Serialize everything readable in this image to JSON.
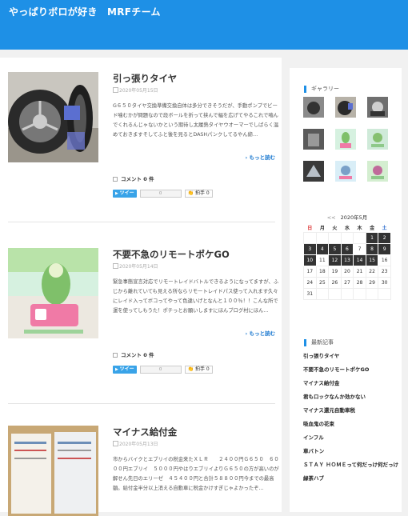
{
  "site": {
    "title": "やっぱりボロが好き　MRFチーム"
  },
  "posts": [
    {
      "title": "引っ張りタイヤ",
      "date": "2020年05月15日",
      "excerpt": "G６５０タイヤ交換準備交換自体は多分できそうだが、手動ポンプでビード噛むかが問題なので段ボールを折って挟んで幅を広げてやるこれで嚙んでくれるんじゃないかという期待し太履熱タイヤウオーマーでしばらく温めておきますそしてふと後を見るとDASHパンクしてるやん締…",
      "more": "もっと読む",
      "comment": "コメント 0 件",
      "tweet": "ツイー",
      "count": "0",
      "clap": "拍手 0"
    },
    {
      "title": "不要不急のリモートポケGO",
      "date": "2020年05月14日",
      "excerpt": "緊急事態宣言対応でリモートレイドバトルできるようになってますが、ふじから離れていても見える所ならリモートレイドパス使って入れます久々にレイド入ってボコってやって色違いげとなんと１００％！！こんな所で運を使ってしもうた！ポチっとお願いしますにほんブログ村にほん…",
      "more": "もっと読む",
      "comment": "コメント 0 件",
      "tweet": "ツイー",
      "count": "0",
      "clap": "拍手 0"
    },
    {
      "title": "マイナス給付金",
      "date": "2020年05月13日",
      "excerpt": "市からバイクとエブリイの税金来たＸＬＲ　　２４００円Ｇ６５０　６０００円エブリイ　５０００円やはりエブリイよりＧ６５０の方が高いのが解せん先日のエリーゼ　４５４００円と合計５８８００円今までの最高額。給付金半分以上消える自動車に税金かけすぎじゃよかったぞ…"
    }
  ],
  "sidebar": {
    "gallery_title": "ギャラリー",
    "calendar": {
      "prev": "<<",
      "title": "2020年5月",
      "weekdays": [
        "日",
        "月",
        "火",
        "水",
        "木",
        "金",
        "土"
      ],
      "rows": [
        [
          "",
          "",
          "",
          "",
          "",
          "1",
          "2"
        ],
        [
          "3",
          "4",
          "5",
          "6",
          "7",
          "8",
          "9"
        ],
        [
          "10",
          "11",
          "12",
          "13",
          "14",
          "15",
          "16"
        ],
        [
          "17",
          "18",
          "19",
          "20",
          "21",
          "22",
          "23"
        ],
        [
          "24",
          "25",
          "26",
          "27",
          "28",
          "29",
          "30"
        ],
        [
          "31",
          "",
          "",
          "",
          "",
          "",
          ""
        ]
      ],
      "active_days": [
        "1",
        "2",
        "3",
        "4",
        "5",
        "6",
        "8",
        "9",
        "10",
        "12",
        "13",
        "14",
        "15"
      ]
    },
    "recent_title": "最新記事",
    "recent": [
      "引っ張りタイヤ",
      "不要不急のリモートポケGO",
      "マイナス給付金",
      "君もロックなんか効かない",
      "マイナス還元自動車税",
      "吸血鬼の花束",
      "インフル",
      "車バトン",
      "ＳＴＡＹ ＨＯＭＥって何だっけ何だっけ",
      "緑茶ハブ"
    ]
  },
  "colors": {
    "header": "#1e90e6",
    "link": "#1e7ad0"
  }
}
